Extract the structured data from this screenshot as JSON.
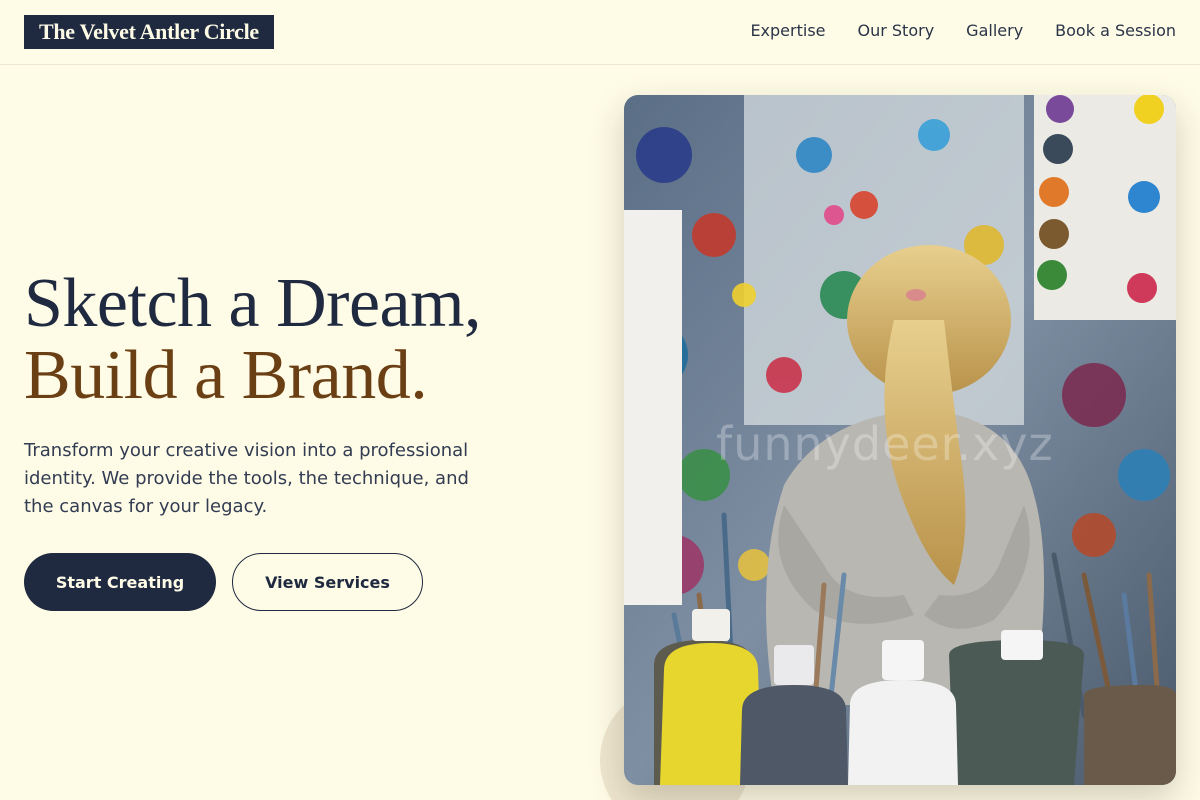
{
  "brand": {
    "name": "The Velvet Antler Circle"
  },
  "nav": {
    "items": [
      {
        "label": "Expertise"
      },
      {
        "label": "Our Story"
      },
      {
        "label": "Gallery"
      },
      {
        "label": "Book a Session"
      }
    ]
  },
  "hero": {
    "headline_line1": "Sketch a Dream,",
    "headline_line2": "Build a Brand.",
    "description": "Transform your creative vision into a professional identity. We provide the tools, the technique, and the canvas for your legacy.",
    "primary_cta": "Start Creating",
    "secondary_cta": "View Services",
    "image_alt": "Child with a blonde ponytail facing a paint-splattered wall, paint bottles and brush jars in the foreground",
    "watermark": "funnydeer.xyz"
  },
  "colors": {
    "background": "#fefbe6",
    "navy": "#1f2a40",
    "brown_accent": "#6b3f14"
  }
}
